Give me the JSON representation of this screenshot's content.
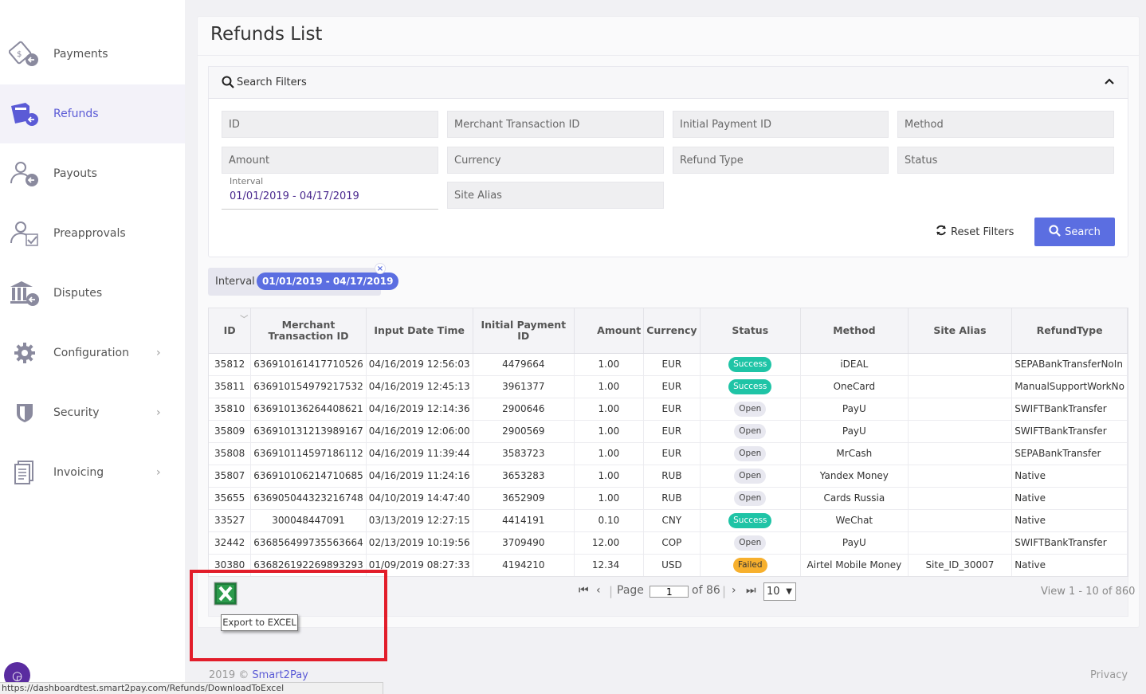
{
  "sidebar": {
    "items": [
      {
        "label": "Payments",
        "icon": "payments-icon",
        "active": false
      },
      {
        "label": "Refunds",
        "icon": "refunds-icon",
        "active": true
      },
      {
        "label": "Payouts",
        "icon": "payouts-icon",
        "active": false
      },
      {
        "label": "Preapprovals",
        "icon": "preapprovals-icon",
        "active": false
      },
      {
        "label": "Disputes",
        "icon": "disputes-icon",
        "active": false
      },
      {
        "label": "Configuration",
        "icon": "gear-icon",
        "active": false,
        "chevron": "›"
      },
      {
        "label": "Security",
        "icon": "shield-icon",
        "active": false,
        "chevron": "›"
      },
      {
        "label": "Invoicing",
        "icon": "document-icon",
        "active": false,
        "chevron": "›"
      }
    ]
  },
  "page": {
    "title": "Refunds List"
  },
  "filters": {
    "title": "Search Filters",
    "fields": {
      "id": "ID",
      "merchant_tx": "Merchant Transaction ID",
      "initial_payment": "Initial Payment ID",
      "method": "Method",
      "amount": "Amount",
      "currency": "Currency",
      "refund_type": "Refund Type",
      "status": "Status",
      "site_alias": "Site Alias"
    },
    "interval_label": "Interval",
    "interval_value": "01/01/2019 - 04/17/2019",
    "reset_label": "Reset Filters",
    "search_label": "Search"
  },
  "active_filter": {
    "label": "Interval",
    "value": "01/01/2019 - 04/17/2019",
    "remove": "×"
  },
  "table": {
    "headers": [
      "ID",
      "Merchant Transaction ID",
      "Input Date Time",
      "Initial Payment ID",
      "Amount",
      "Currency",
      "Status",
      "Method",
      "Site Alias",
      "RefundType"
    ],
    "rows": [
      [
        "35812",
        "636910161417710526",
        "04/16/2019 12:56:03",
        "4479664",
        "1.00",
        "EUR",
        "Success",
        "iDEAL",
        "",
        "SEPABankTransferNoIn"
      ],
      [
        "35811",
        "636910154979217532",
        "04/16/2019 12:45:13",
        "3961377",
        "1.00",
        "EUR",
        "Success",
        "OneCard",
        "",
        "ManualSupportWorkNo"
      ],
      [
        "35810",
        "636910136264408621",
        "04/16/2019 12:14:36",
        "2900646",
        "1.00",
        "EUR",
        "Open",
        "PayU",
        "",
        "SWIFTBankTransfer"
      ],
      [
        "35809",
        "636910131213989167",
        "04/16/2019 12:06:00",
        "2900569",
        "1.00",
        "EUR",
        "Open",
        "PayU",
        "",
        "SWIFTBankTransfer"
      ],
      [
        "35808",
        "636910114597186112",
        "04/16/2019 11:39:44",
        "3583723",
        "1.00",
        "EUR",
        "Open",
        "MrCash",
        "",
        "SEPABankTransfer"
      ],
      [
        "35807",
        "636910106214710685",
        "04/16/2019 11:24:16",
        "3653283",
        "1.00",
        "RUB",
        "Open",
        "Yandex Money",
        "",
        "Native"
      ],
      [
        "35655",
        "636905044323216748",
        "04/10/2019 14:47:40",
        "3652909",
        "1.00",
        "RUB",
        "Open",
        "Cards Russia",
        "",
        "Native"
      ],
      [
        "33527",
        "300048447091",
        "03/13/2019 12:27:15",
        "4414191",
        "0.10",
        "CNY",
        "Success",
        "WeChat",
        "",
        "Native"
      ],
      [
        "32442",
        "636856499735563664",
        "02/13/2019 10:19:56",
        "3709490",
        "12.00",
        "COP",
        "Open",
        "PayU",
        "",
        "SWIFTBankTransfer"
      ],
      [
        "30380",
        "636826192269893293",
        "01/09/2019 08:27:33",
        "4194210",
        "12.34",
        "USD",
        "Failed",
        "Airtel Mobile Money",
        "Site_ID_30007",
        "Native"
      ]
    ]
  },
  "pager": {
    "page_label": "Page",
    "current_page": "1",
    "of_label": "of 86",
    "page_size": "10",
    "view_info": "View 1 - 10 of 860"
  },
  "export": {
    "tooltip": "Export to EXCEL",
    "icon": "excel-icon"
  },
  "footer": {
    "copy_prefix": "2019 ©",
    "brand": "Smart2Pay",
    "privacy": "Privacy"
  },
  "statusbar": {
    "url": "https://dashboardtest.smart2pay.com/Refunds/DownloadToExcel"
  },
  "colors": {
    "accent": "#5b6ee1",
    "success": "#1fc4a6",
    "failed": "#f7b02d",
    "highlight": "#e21d2a"
  }
}
